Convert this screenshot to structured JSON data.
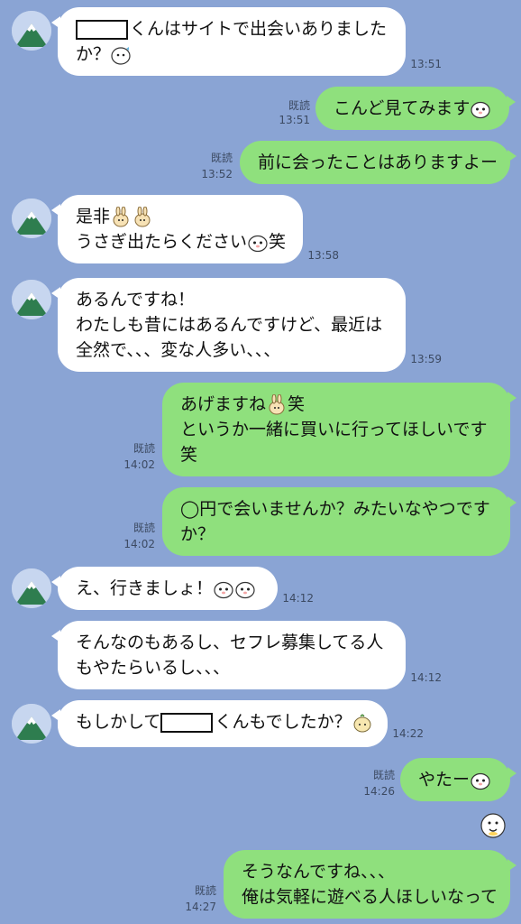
{
  "read_label": "既読",
  "messages": [
    {
      "id": "m1",
      "dir": "in",
      "lines": [
        "くんはサイトで出会いありました",
        "か？"
      ],
      "time": "13:51"
    },
    {
      "id": "m2",
      "dir": "out",
      "lines": [
        "こんど見てみます"
      ],
      "time": "13:51",
      "read": "既読"
    },
    {
      "id": "m3",
      "dir": "out",
      "lines": [
        "前に会ったことはありますよー"
      ],
      "time": "13:52",
      "read": "既読"
    },
    {
      "id": "m4",
      "dir": "in",
      "lines": [
        "是非",
        "うさぎ出たらください",
        "笑"
      ],
      "time": "13:58"
    },
    {
      "id": "m5",
      "dir": "in",
      "lines": [
        "あるんですね！",
        "わたしも昔にはあるんですけど、最近は",
        "全然で、、、変な人多い、、、"
      ],
      "time": "13:59"
    },
    {
      "id": "m6",
      "dir": "out",
      "lines": [
        "あげますね",
        "笑",
        "というか一緒に買いに行ってほしいです",
        "笑"
      ],
      "time": "14:02",
      "read": "既読"
    },
    {
      "id": "m7",
      "dir": "out",
      "lines": [
        "◯円で会いませんか？みたいなやつです",
        "か？"
      ],
      "time": "14:02",
      "read": "既読"
    },
    {
      "id": "m8",
      "dir": "in",
      "lines": [
        "え、行きましょ！"
      ],
      "time": "14:12"
    },
    {
      "id": "m9",
      "dir": "in",
      "lines": [
        "そんなのもあるし、セフレ募集してる人",
        "もやたらいるし、、、"
      ],
      "time": "14:12"
    },
    {
      "id": "m10",
      "dir": "in",
      "lines": [
        "もしかして",
        "くんもでしたか？"
      ],
      "time": "14:22"
    },
    {
      "id": "m11",
      "dir": "out",
      "lines": [
        "やたー"
      ],
      "time": "14:26",
      "read": "既読"
    },
    {
      "id": "m12",
      "dir": "out",
      "lines": [
        "そうなんですね、、、",
        "俺は気軽に遊べる人ほしいなって"
      ],
      "time": "14:27",
      "read": "既読"
    }
  ],
  "colors": {
    "background": "#8aa4d4",
    "incoming": "#ffffff",
    "outgoing": "#8fe07d"
  }
}
